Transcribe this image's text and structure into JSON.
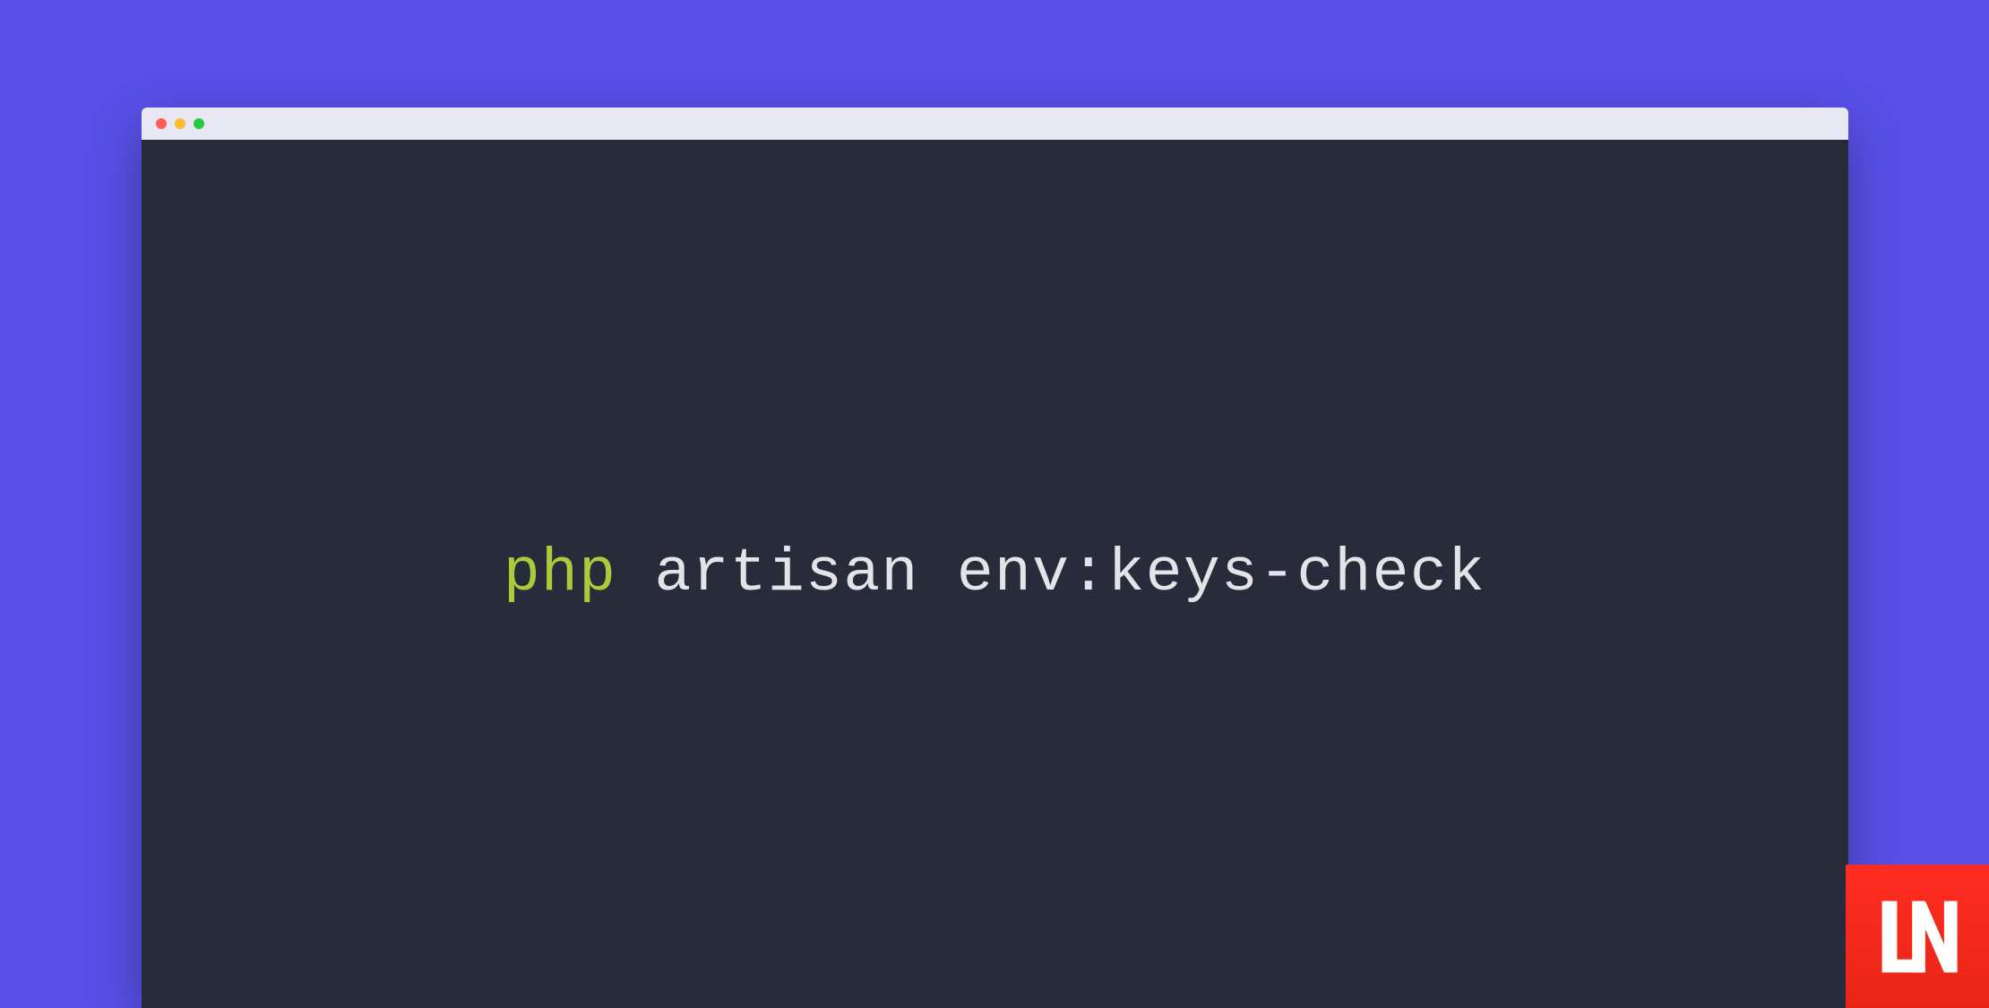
{
  "terminal": {
    "command_keyword": "php",
    "command_args": " artisan env:keys-check"
  },
  "colors": {
    "page_background": "#5850e8",
    "terminal_background": "#282c3a",
    "titlebar_background": "#e8e8f5",
    "keyword_color": "#a8cc3c",
    "args_color": "#e4e4e8",
    "logo_background": "#ff2d20",
    "traffic_close": "#ff5f57",
    "traffic_minimize": "#febc2e",
    "traffic_maximize": "#28c840"
  },
  "logo": {
    "text": "LN"
  }
}
